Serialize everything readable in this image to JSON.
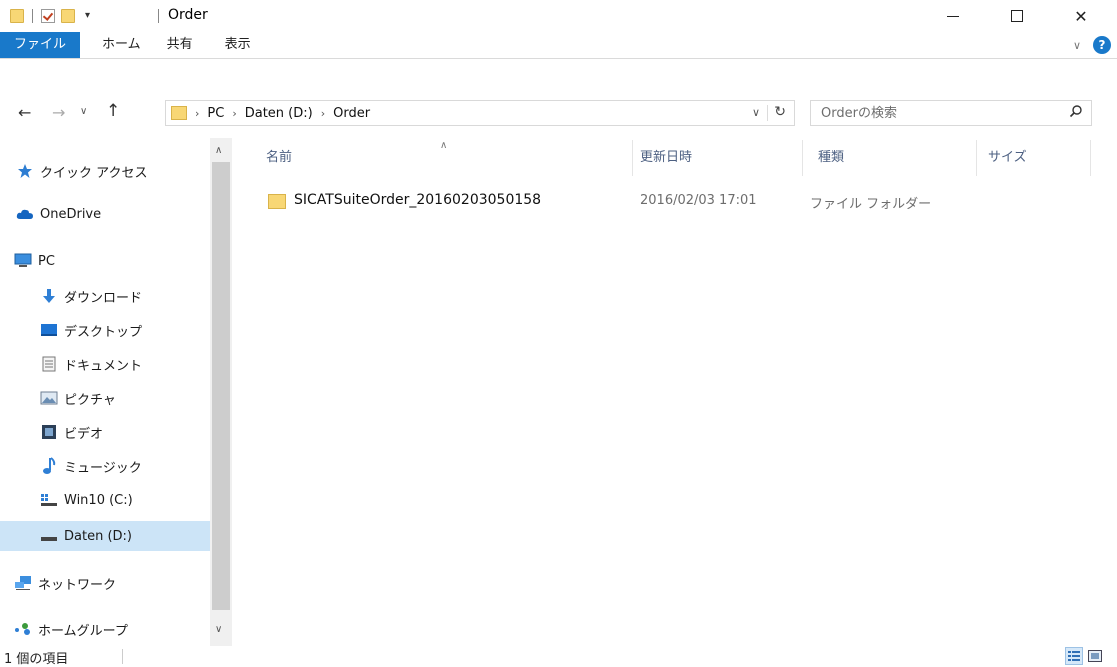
{
  "window": {
    "title": "Order"
  },
  "ribbon": {
    "tabs": [
      "ファイル",
      "ホーム",
      "共有",
      "表示"
    ]
  },
  "address": {
    "crumbs": [
      "PC",
      "Daten (D:)",
      "Order"
    ]
  },
  "search": {
    "placeholder": "Orderの検索"
  },
  "navpane": {
    "items": [
      {
        "label": "クイック アクセス",
        "icon": "star-icon"
      },
      {
        "label": "OneDrive",
        "icon": "cloud-icon"
      },
      {
        "label": "PC",
        "icon": "computer-icon"
      },
      {
        "label": "ダウンロード",
        "icon": "download-arrow-icon"
      },
      {
        "label": "デスクトップ",
        "icon": "desktop-icon"
      },
      {
        "label": "ドキュメント",
        "icon": "document-icon"
      },
      {
        "label": "ピクチャ",
        "icon": "picture-icon"
      },
      {
        "label": "ビデオ",
        "icon": "video-icon"
      },
      {
        "label": "ミュージック",
        "icon": "music-note-icon"
      },
      {
        "label": "Win10 (C:)",
        "icon": "windows-drive-icon"
      },
      {
        "label": "Daten (D:)",
        "icon": "drive-icon",
        "selected": true
      },
      {
        "label": "ネットワーク",
        "icon": "network-icon"
      },
      {
        "label": "ホームグループ",
        "icon": "homegroup-icon"
      }
    ]
  },
  "columns": {
    "name": "名前",
    "date": "更新日時",
    "type": "種類",
    "size": "サイズ"
  },
  "files": [
    {
      "name": "SICATSuiteOrder_20160203050158",
      "date": "2016/02/03 17:01",
      "type": "ファイル フォルダー",
      "size": ""
    }
  ],
  "status": {
    "text": "1 個の項目"
  },
  "colors": {
    "accent": "#1979ca",
    "selection": "#cce4f7",
    "folder": "#f8d775",
    "header_text": "#4d6082"
  }
}
